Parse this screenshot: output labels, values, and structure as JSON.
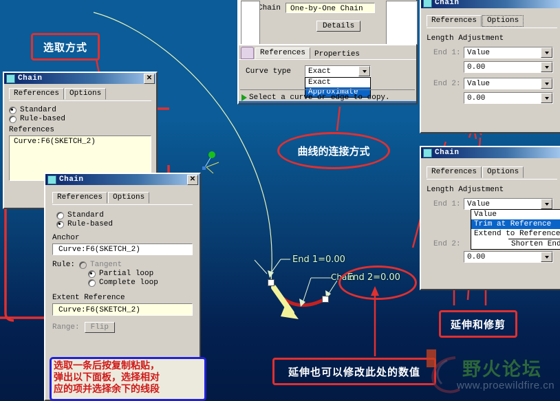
{
  "background": {
    "top_color": "#0b5c98",
    "bottom_color": "#021a43"
  },
  "canvas": {
    "labels": [
      {
        "name": "end1-label",
        "text": "End 1=0.00"
      },
      {
        "name": "end2-label",
        "text": "End 2=0.00"
      },
      {
        "name": "chain-label",
        "text": "Chain"
      }
    ]
  },
  "dialog_chain_left": {
    "title": "Chain",
    "close_label": "✕",
    "tabs": [
      {
        "label": "References",
        "active": true
      },
      {
        "label": "Options",
        "active": false
      }
    ],
    "radios": [
      {
        "label": "Standard",
        "selected": true
      },
      {
        "label": "Rule-based",
        "selected": false
      }
    ],
    "references_label": "References",
    "reference_item": "Curve:F6(SKETCH_2)"
  },
  "dialog_chain_mid": {
    "title": "Chain",
    "close_label": "✕",
    "tabs": [
      {
        "label": "References",
        "active": true
      },
      {
        "label": "Options",
        "active": false
      }
    ],
    "radios": [
      {
        "label": "Standard",
        "selected": false
      },
      {
        "label": "Rule-based",
        "selected": true
      }
    ],
    "anchor_label": "Anchor",
    "anchor_value": "Curve:F6(SKETCH_2)",
    "rule_label": "Rule:",
    "rule_options": [
      {
        "label": "Tangent",
        "selected": false,
        "disabled": true
      },
      {
        "label": "Partial loop",
        "selected": true,
        "disabled": false
      },
      {
        "label": "Complete loop",
        "selected": false,
        "disabled": false
      }
    ],
    "extent_label": "Extent Reference",
    "extent_value": "Curve:F6(SKETCH_2)",
    "range_label": "Range:",
    "flip_label": "Flip"
  },
  "dialog_top_center": {
    "chain_label": "Chain",
    "chain_value": "One-by-One Chain",
    "details_button": "Details",
    "tabs": [
      {
        "label": "References",
        "active": true
      },
      {
        "label": "Properties",
        "active": false
      }
    ],
    "curve_type_label": "Curve type",
    "curve_type_value": "Exact",
    "curve_type_options": [
      {
        "label": "Exact",
        "selected": false
      },
      {
        "label": "Approximate",
        "selected": true
      }
    ],
    "status_text": "Select a curve or edge to copy."
  },
  "dialog_chain_tr": {
    "title": "Chain",
    "tabs": [
      {
        "label": "References",
        "active": false
      },
      {
        "label": "Options",
        "active": true
      }
    ],
    "section_label": "Length Adjustment",
    "rows": [
      {
        "label": "End 1:",
        "mode": "Value",
        "value": "0.00"
      },
      {
        "label": "End 2:",
        "mode": "Value",
        "value": "0.00"
      }
    ]
  },
  "dialog_chain_br": {
    "title": "Chain",
    "tabs": [
      {
        "label": "References",
        "active": false
      },
      {
        "label": "Options",
        "active": true
      }
    ],
    "section_label": "Length Adjustment",
    "rows": [
      {
        "label": "End 1:",
        "mode": "Value",
        "value": ""
      },
      {
        "label": "End 2:",
        "mode": "Value",
        "value": "0.00"
      }
    ],
    "dropdown_options": [
      {
        "label": "Value",
        "selected": false
      },
      {
        "label": "Trim at Reference",
        "selected": true
      },
      {
        "label": "Extend to Reference",
        "selected": false
      },
      {
        "label": "Shorten End",
        "selected": false
      }
    ]
  },
  "annotations": [
    {
      "name": "annot-selection-method",
      "text": "选取方式",
      "shape": "box"
    },
    {
      "name": "annot-curve-connect-method",
      "text": "曲线的连接方式",
      "shape": "ellipse"
    },
    {
      "name": "annot-extend-trim",
      "text": "延伸和修剪",
      "shape": "box"
    },
    {
      "name": "annot-extend-modify-value",
      "text": "延伸也可以修改此处的数值",
      "shape": "box"
    }
  ],
  "note_box": {
    "name": "note-copy-paste",
    "lines": [
      "选取一条后按复制粘贴，",
      "弹出以下面板，选择相对",
      "应的项并选择余下的线段"
    ]
  },
  "watermark": {
    "name_cn": "野火论坛",
    "url": "www.proewildfire.cn"
  },
  "colors": {
    "annotation_red": "#e03030",
    "note_blue": "#2020d8",
    "highlight_blue": "#0a64c8"
  }
}
